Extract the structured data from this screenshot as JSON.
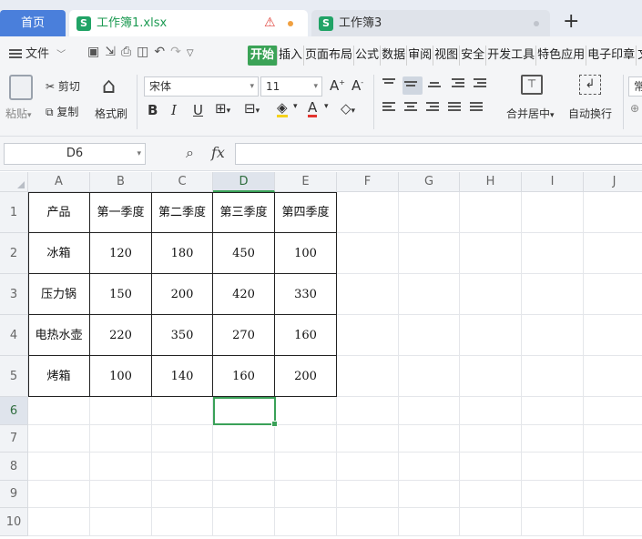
{
  "tabs": {
    "home": "首页",
    "active_doc": "工作簿1.xlsx",
    "other_doc": "工作簿3",
    "new_tab": "+"
  },
  "menu": {
    "file": "文件",
    "tabs": [
      "开始",
      "插入",
      "页面布局",
      "公式",
      "数据",
      "审阅",
      "视图",
      "安全",
      "开发工具",
      "特色应用",
      "电子印章",
      "文"
    ]
  },
  "ribbon": {
    "paste": "粘贴",
    "cut": "剪切",
    "copy": "复制",
    "format_painter": "格式刷",
    "font_name": "宋体",
    "font_size": "11",
    "merge_center": "合并居中",
    "wrap_text": "自动换行",
    "number_format": "常"
  },
  "formula_bar": {
    "name_box": "D6",
    "fx": "fx",
    "formula": ""
  },
  "sheet": {
    "columns": [
      "A",
      "B",
      "C",
      "D",
      "E",
      "F",
      "G",
      "H",
      "I",
      "J"
    ],
    "rows": [
      "1",
      "2",
      "3",
      "4",
      "5",
      "6",
      "7",
      "8",
      "9",
      "10"
    ],
    "selected_cell": "D6",
    "table": [
      [
        "产品",
        "第一季度",
        "第二季度",
        "第三季度",
        "第四季度"
      ],
      [
        "冰箱",
        "120",
        "180",
        "450",
        "100"
      ],
      [
        "压力锅",
        "150",
        "200",
        "420",
        "330"
      ],
      [
        "电热水壶",
        "220",
        "350",
        "270",
        "160"
      ],
      [
        "烤箱",
        "100",
        "140",
        "160",
        "200"
      ]
    ]
  },
  "colors": {
    "accent_green": "#3aa158",
    "home_tab_blue": "#4a7fdb",
    "active_menu_green": "#3ba357"
  }
}
